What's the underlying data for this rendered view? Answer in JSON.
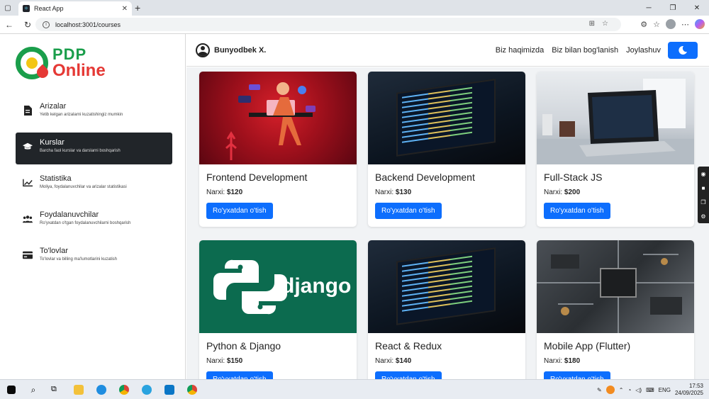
{
  "browser": {
    "tab_title": "React App",
    "url": "localhost:3001/courses"
  },
  "logo": {
    "line1": "PDP",
    "line2": "Online"
  },
  "sidebar": {
    "items": [
      {
        "title": "Arizalar",
        "subtitle": "Yetib kelgan arizalarni kuzatishingiz mumkin",
        "icon": "document-icon",
        "active": false
      },
      {
        "title": "Kurslar",
        "subtitle": "Barcha faol kurslar va darslarni boshqarish",
        "icon": "graduation-cap-icon",
        "active": true
      },
      {
        "title": "Statistika",
        "subtitle": "Moliya, foydalanuvchilar va arizalar statistikasi",
        "icon": "chart-line-icon",
        "active": false
      },
      {
        "title": "Foydalanuvchilar",
        "subtitle": "Ro'yxatdan o'tgan foydalanuvchilarni boshqarish",
        "icon": "users-icon",
        "active": false
      },
      {
        "title": "To'lovlar",
        "subtitle": "To'lovlar va billing ma'lumotlarini kuzatish",
        "icon": "credit-card-icon",
        "active": false
      }
    ]
  },
  "header": {
    "user_name": "Bunyodbek X.",
    "links": [
      "Biz haqimizda",
      "Biz bilan bog'lanish",
      "Joylashuv"
    ],
    "theme_icon": "moon-icon"
  },
  "courses": [
    {
      "title": "Frontend Development",
      "price_label": "Narxi:",
      "price": "$120",
      "button": "Ro'yxatdan o'tish",
      "image": "frontend-illustration"
    },
    {
      "title": "Backend Development",
      "price_label": "Narxi:",
      "price": "$130",
      "button": "Ro'yxatdan o'tish",
      "image": "code-laptop"
    },
    {
      "title": "Full-Stack JS",
      "price_label": "Narxi:",
      "price": "$200",
      "button": "Ro'yxatdan o'tish",
      "image": "desk-laptop"
    },
    {
      "title": "Python & Django",
      "price_label": "Narxi:",
      "price": "$150",
      "button": "Ro'yxatdan o'tish",
      "image": "django-logo",
      "image_text": "django"
    },
    {
      "title": "React & Redux",
      "price_label": "Narxi:",
      "price": "$140",
      "button": "Ro'yxatdan o'tish",
      "image": "code-laptop"
    },
    {
      "title": "Mobile App (Flutter)",
      "price_label": "Narxi:",
      "price": "$180",
      "button": "Ro'yxatdan o'tish",
      "image": "circuit-board"
    }
  ],
  "taskbar": {
    "lang": "ENG",
    "time": "17:53",
    "date": "24/09/2025"
  },
  "colors": {
    "primary": "#0d6efd",
    "active_menu": "#212529",
    "brand_green": "#1a9e4b",
    "brand_red": "#e53935"
  }
}
